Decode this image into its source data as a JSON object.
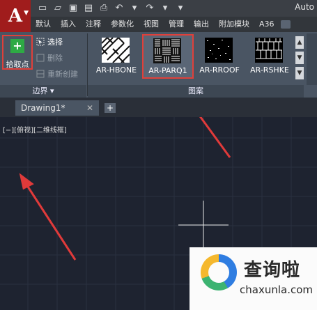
{
  "app": {
    "logo_letter": "A",
    "title": "Auto"
  },
  "ribbon_tabs": [
    "默认",
    "插入",
    "注释",
    "参数化",
    "视图",
    "管理",
    "输出",
    "附加模块",
    "A36"
  ],
  "boundary_panel": {
    "pick_points_label": "拾取点",
    "select_label": "选择",
    "remove_label": "删除",
    "recreate_label": "重新创建",
    "footer_label": "边界"
  },
  "pattern_panel": {
    "footer_label": "图案",
    "patterns": [
      {
        "name": "AR-HBONE",
        "icon": "herringbone-swatch"
      },
      {
        "name": "AR-PARQ1",
        "icon": "parquet-swatch",
        "selected": true
      },
      {
        "name": "AR-RROOF",
        "icon": "roof-dots-swatch"
      },
      {
        "name": "AR-RSHKE",
        "icon": "shake-swatch"
      }
    ]
  },
  "file_tab": {
    "name": "Drawing1*"
  },
  "viewport_label": "[−][俯视][二维线框]",
  "watermark": {
    "brand_cn": "查询啦",
    "brand_en": "chaxunla.com"
  },
  "colors": {
    "highlight_red": "#e0403a",
    "canvas_bg": "#1e2330",
    "ribbon_bg": "#4a5563"
  }
}
